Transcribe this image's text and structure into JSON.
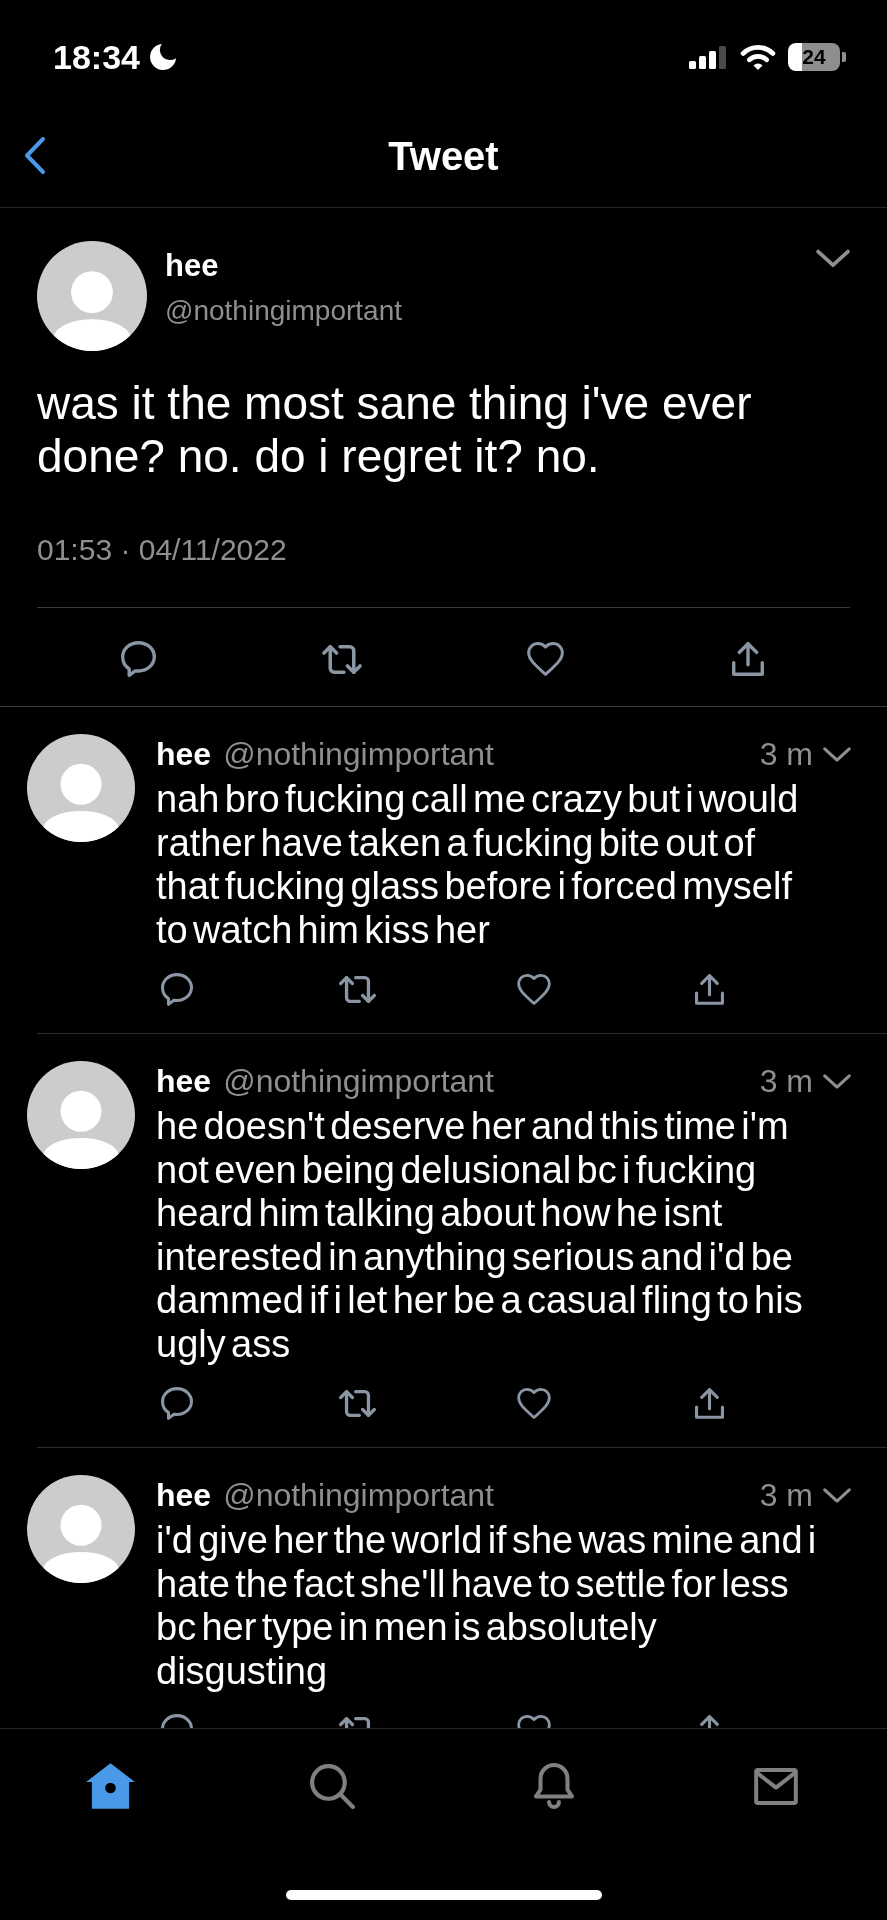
{
  "status_bar": {
    "time": "18:34",
    "battery": "24"
  },
  "header": {
    "title": "Tweet"
  },
  "tweet": {
    "name": "hee",
    "handle": "@nothingimportant",
    "text": "was it the most sane thing i've ever done? no. do i regret it? no.",
    "timestamp": "01:53 · 04/11/2022"
  },
  "replies": [
    {
      "name": "hee",
      "handle": "@nothingimportant",
      "time": "3 m",
      "text": "nah bro fucking call me crazy but i would rather have taken a fucking bite out of that fucking glass before i forced myself to watch him kiss her"
    },
    {
      "name": "hee",
      "handle": "@nothingimportant",
      "time": "3 m",
      "text": "he doesn't deserve her and this time i'm not even being delusional bc i fucking heard him talking about how he isnt interested in anything serious and i'd be dammed if i let her be a casual fling to his ugly ass"
    },
    {
      "name": "hee",
      "handle": "@nothingimportant",
      "time": "3 m",
      "text": "i'd give her the world if she was mine and i hate the fact she'll have to settle for less bc her type in men is absolutely disgusting"
    }
  ],
  "tab_bar": [
    {
      "kind": "home",
      "selected": true
    },
    {
      "kind": "search",
      "selected": false
    },
    {
      "kind": "notifications",
      "selected": false
    },
    {
      "kind": "messages",
      "selected": false
    }
  ]
}
